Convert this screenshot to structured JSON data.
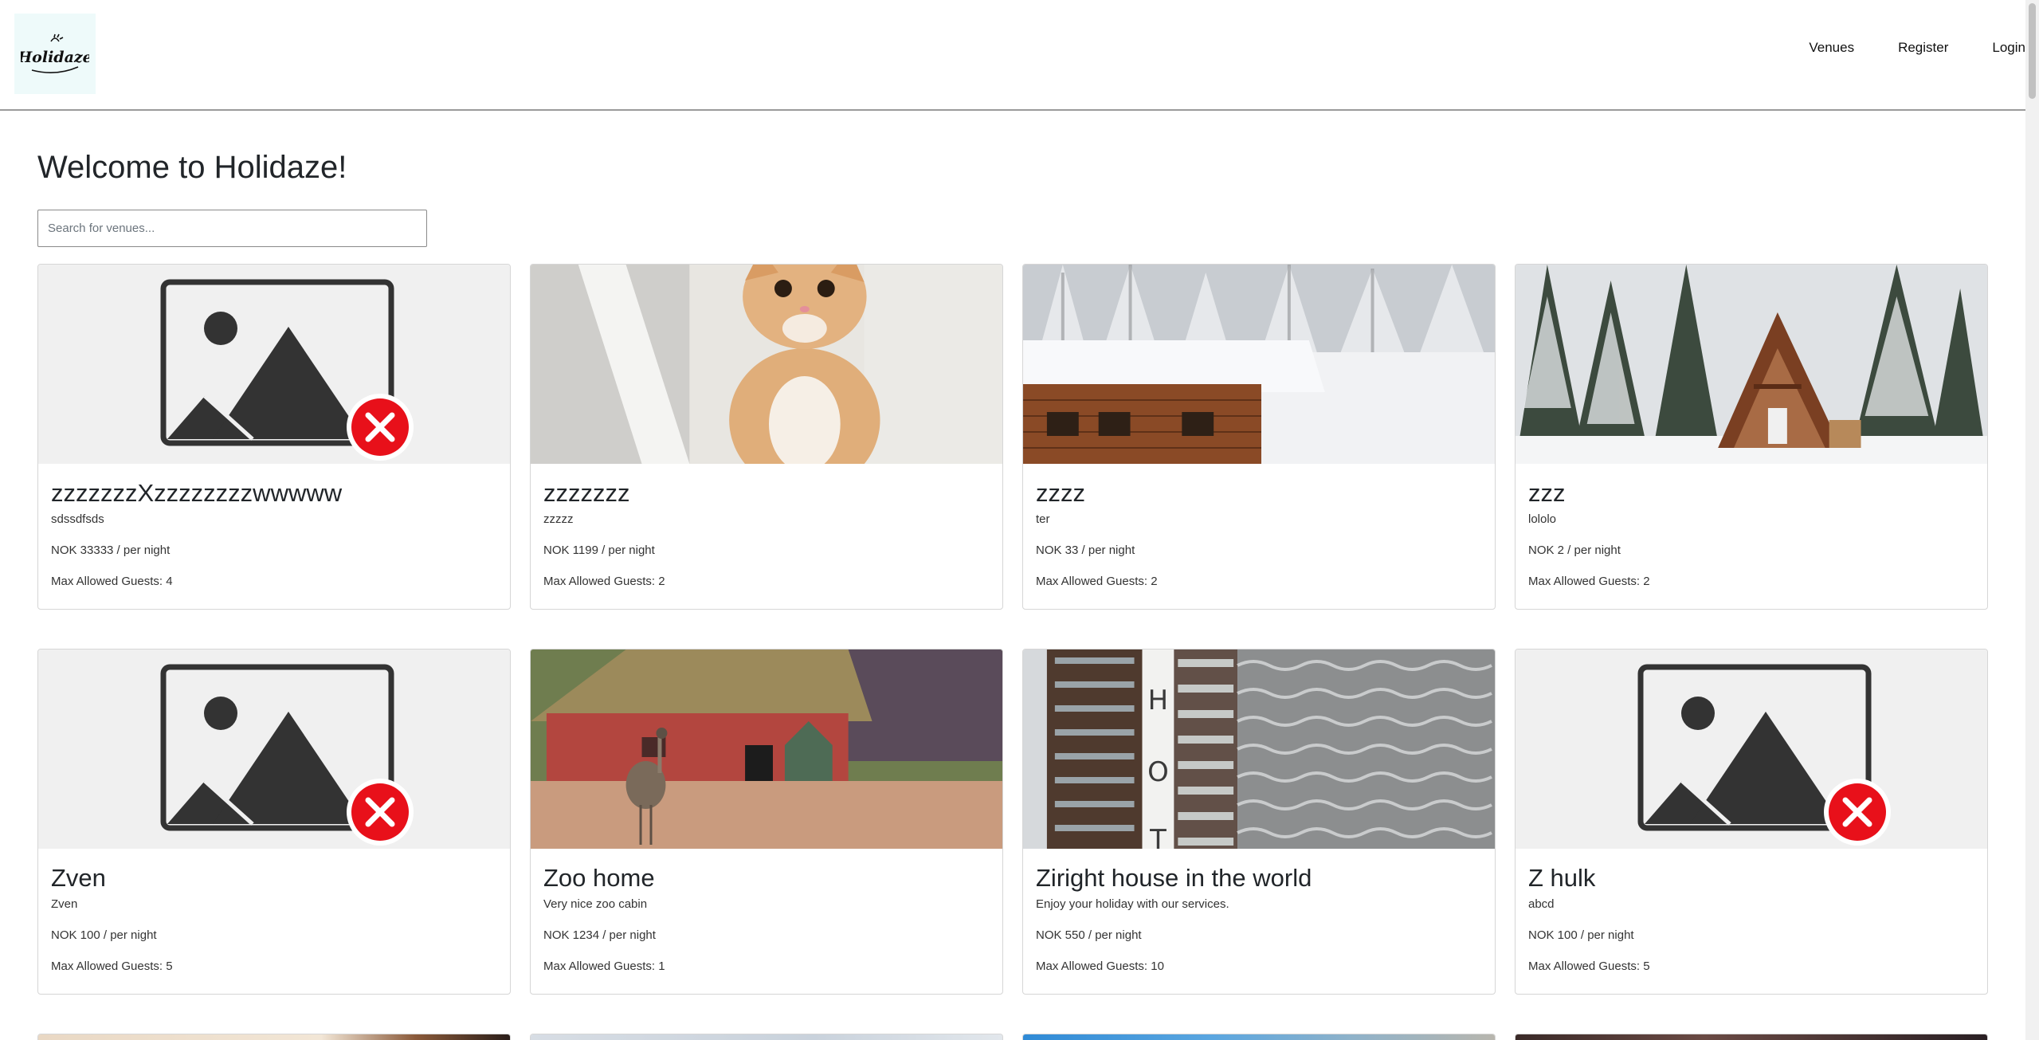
{
  "brand": {
    "name": "Holidaze"
  },
  "nav": {
    "venues": "Venues",
    "register": "Register",
    "login": "Login"
  },
  "main": {
    "title": "Welcome to Holidaze!",
    "search_placeholder": "Search for venues..."
  },
  "venues": [
    {
      "name": "zzzzzzzXzzzzzzzzwwwww",
      "description": "sdssdfsds",
      "price": "NOK 33333 / per night",
      "guests": "Max Allowed Guests: 4",
      "image": "placeholder-broken"
    },
    {
      "name": "zzzzzzz",
      "description": "zzzzz",
      "price": "NOK 1199 / per night",
      "guests": "Max Allowed Guests: 2",
      "image": "kitten"
    },
    {
      "name": "zzzz",
      "description": "ter",
      "price": "NOK 33 / per night",
      "guests": "Max Allowed Guests: 2",
      "image": "snowy-cabin"
    },
    {
      "name": "zzz",
      "description": "lololo",
      "price": "NOK 2 / per night",
      "guests": "Max Allowed Guests: 2",
      "image": "a-frame-cabin"
    },
    {
      "name": "Zven",
      "description": "Zven",
      "price": "NOK 100 / per night",
      "guests": "Max Allowed Guests: 5",
      "image": "placeholder-broken"
    },
    {
      "name": "Zoo home",
      "description": "Very nice zoo cabin",
      "price": "NOK 1234 / per night",
      "guests": "Max Allowed Guests: 1",
      "image": "zoo-emu"
    },
    {
      "name": "Ziright house in the world",
      "description": "Enjoy your holiday with our services.",
      "price": "NOK 550 / per night",
      "guests": "Max Allowed Guests: 10",
      "image": "hotel-building"
    },
    {
      "name": "Z hulk",
      "description": "abcd",
      "price": "NOK 100 / per night",
      "guests": "Max Allowed Guests: 5",
      "image": "placeholder-broken"
    }
  ],
  "colors": {
    "page_bg": "#ffffff",
    "logo_bg": "#eefafa",
    "card_border": "#d6d6d6",
    "placeholder_bg": "#f0f0f0",
    "error_red": "#e8101a"
  }
}
